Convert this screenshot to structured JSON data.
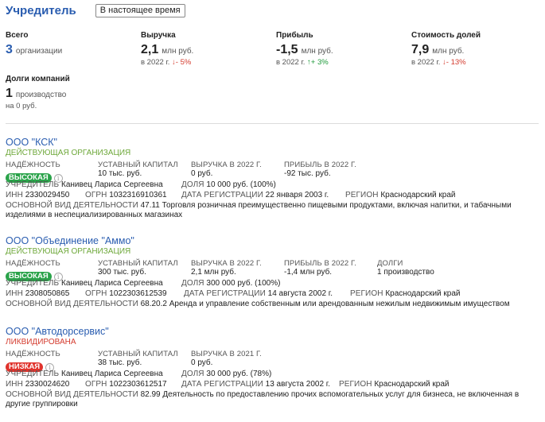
{
  "header": {
    "title": "Учредитель",
    "badge": "В настоящее время"
  },
  "stats": {
    "total": {
      "label": "Всего",
      "value": "3",
      "unit": "организации"
    },
    "revenue": {
      "label": "Выручка",
      "value": "2,1",
      "unit": "млн руб.",
      "year": "в 2022 г.",
      "arrow": "↓",
      "delta": "- 5%"
    },
    "profit": {
      "label": "Прибыль",
      "value": "-1,5",
      "unit": "млн руб.",
      "year": "в 2022 г.",
      "arrow": "↑",
      "delta": "+ 3%"
    },
    "shares": {
      "label": "Стоимость долей",
      "value": "7,9",
      "unit": "млн руб.",
      "year": "в 2022 г.",
      "arrow": "↓",
      "delta": "- 13%"
    },
    "debts": {
      "label": "Долги компаний",
      "value": "1",
      "unit": "производство",
      "sub": "на 0 руб."
    }
  },
  "labels": {
    "reliability": "НАДЁЖНОСТЬ",
    "capital": "УСТАВНЫЙ КАПИТАЛ",
    "founder": "УЧРЕДИТЕЛЬ",
    "share": "ДОЛЯ",
    "inn": "ИНН",
    "ogrn": "ОГРН",
    "reg_date": "ДАТА РЕГИСТРАЦИИ",
    "region": "РЕГИОН",
    "activity": "ОСНОВНОЙ ВИД ДЕЯТЕЛЬНОСТИ",
    "debts": "ДОЛГИ",
    "info_glyph": "i"
  },
  "orgs": [
    {
      "name": "ООО \"КСК\"",
      "status": "ДЕЙСТВУЮЩАЯ ОРГАНИЗАЦИЯ",
      "reliability": "ВЫСОКАЯ",
      "capital": "10 тыс. руб.",
      "revenue_label": "ВЫРУЧКА В 2022 Г.",
      "revenue": "0 руб.",
      "profit_label": "ПРИБЫЛЬ В 2022 Г.",
      "profit": "-92 тыс. руб.",
      "founder": "Канивец Лариса Сергеевна",
      "share": "10 000 руб. (100%)",
      "inn": "2330029450",
      "ogrn": "1032316910361",
      "reg_date": "22 января 2003 г.",
      "region": "Краснодарский край",
      "activity": "47.11 Торговля розничная преимущественно пищевыми продуктами, включая напитки, и табачными изделиями в неспециализированных магазинах"
    },
    {
      "name": "ООО \"Объединение \"Аммо\"",
      "status": "ДЕЙСТВУЮЩАЯ ОРГАНИЗАЦИЯ",
      "reliability": "ВЫСОКАЯ",
      "capital": "300 тыс. руб.",
      "revenue_label": "ВЫРУЧКА В 2022 Г.",
      "revenue": "2,1 млн руб.",
      "profit_label": "ПРИБЫЛЬ В 2022 Г.",
      "profit": "-1,4 млн руб.",
      "debts": "1 производство",
      "founder": "Канивец Лариса Сергеевна",
      "share": "300 000 руб. (100%)",
      "inn": "2308050865",
      "ogrn": "1022303612539",
      "reg_date": "14 августа 2002 г.",
      "region": "Краснодарский край",
      "activity": "68.20.2 Аренда и управление собственным или арендованным нежилым недвижимым имуществом"
    },
    {
      "name": "ООО \"Автодорсервис\"",
      "status": "ЛИКВИДИРОВАНА",
      "reliability": "НИЗКАЯ",
      "capital": "38 тыс. руб.",
      "revenue_label": "ВЫРУЧКА В 2021 Г.",
      "revenue": "0 руб.",
      "founder": "Канивец Лариса Сергеевна",
      "share": "30 000 руб. (78%)",
      "inn": "2330024620",
      "ogrn": "1022303612517",
      "reg_date": "13 августа 2002 г.",
      "region": "Краснодарский край",
      "activity": "82.99 Деятельность по предоставлению прочих вспомогательных услуг для бизнеса, не включенная в другие группировки"
    }
  ]
}
